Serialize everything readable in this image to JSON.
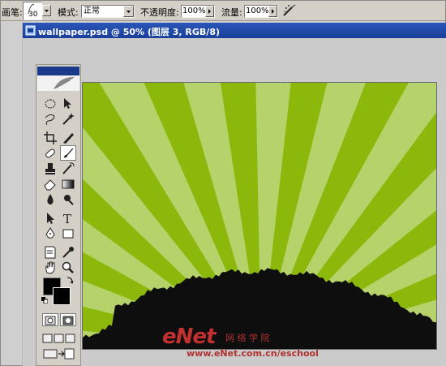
{
  "options_bar": {
    "brush_label": "画笔:",
    "brush_size": "30",
    "mode_label": "模式:",
    "mode_value": "正常",
    "opacity_label": "不透明度:",
    "opacity_value": "100%",
    "flow_label": "流量:",
    "flow_value": "100%",
    "airbrush_icon": "airbrush-icon"
  },
  "document": {
    "title": "wallpaper.psd @ 50% (图层 3, RGB/8)"
  },
  "toolbox": {
    "tools": [
      "marquee-icon",
      "move-icon",
      "lasso-icon",
      "magic-wand-icon",
      "crop-icon",
      "slice-icon",
      "healing-brush-icon",
      "brush-icon",
      "clone-stamp-icon",
      "history-brush-icon",
      "eraser-icon",
      "gradient-icon",
      "blur-icon",
      "dodge-icon",
      "path-select-icon",
      "type-icon",
      "pen-icon",
      "shape-icon",
      "notes-icon",
      "eyedropper-icon",
      "hand-icon",
      "zoom-icon"
    ],
    "selected_tool": "brush-icon"
  },
  "canvas": {
    "colors": {
      "dark_green": "#8cb80c",
      "light_green": "#b5d36a",
      "hill": "#0e0e0e"
    }
  },
  "watermark": {
    "logo": "eNet",
    "tagline": "网 络 学 院",
    "url": "www.eNet.com.cn/eschool"
  }
}
